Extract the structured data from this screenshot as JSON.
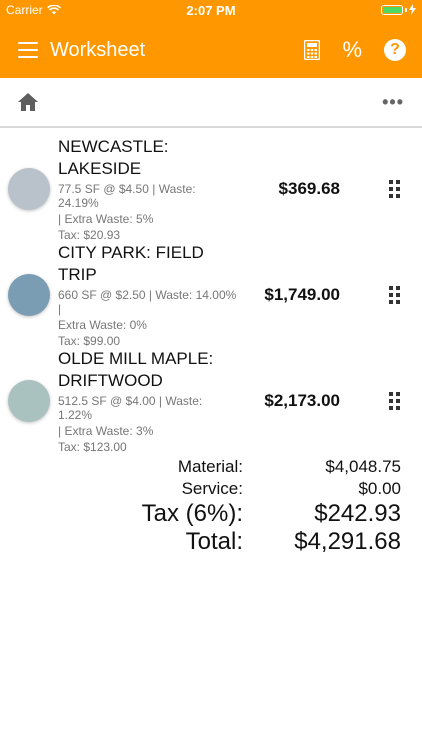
{
  "status": {
    "carrier": "Carrier",
    "time": "2:07 PM"
  },
  "app_bar": {
    "title": "Worksheet",
    "percent_label": "%",
    "help_label": "?"
  },
  "toolbar": {
    "more_label": "•••"
  },
  "items": [
    {
      "name_line1": "NEWCASTLE:",
      "name_line2": "LAKESIDE",
      "detail_line1": "77.5 SF @ $4.50 | Waste: 24.19%",
      "detail_line2": "| Extra Waste: 5%",
      "detail_line3": "Tax: $20.93",
      "price": "$369.68",
      "color": "#b9c1cb"
    },
    {
      "name_line1": "CITY PARK: FIELD",
      "name_line2": "TRIP",
      "detail_line1": "660 SF @ $2.50 | Waste: 14.00% |",
      "detail_line2": "Extra Waste: 0%",
      "detail_line3": "Tax: $99.00",
      "price": "$1,749.00",
      "color": "#7a9db3"
    },
    {
      "name_line1": "OLDE MILL MAPLE:",
      "name_line2": "DRIFTWOOD",
      "detail_line1": "512.5 SF @ $4.00 | Waste: 1.22%",
      "detail_line2": "| Extra Waste: 3%",
      "detail_line3": "Tax: $123.00",
      "price": "$2,173.00",
      "color": "#a9c2c0"
    }
  ],
  "totals": {
    "material_label": "Material:",
    "material_value": "$4,048.75",
    "service_label": "Service:",
    "service_value": "$0.00",
    "tax_label": "Tax (6%):",
    "tax_value": "$242.93",
    "total_label": "Total:",
    "total_value": "$4,291.68"
  },
  "colors": {
    "accent": "#ff9800"
  }
}
